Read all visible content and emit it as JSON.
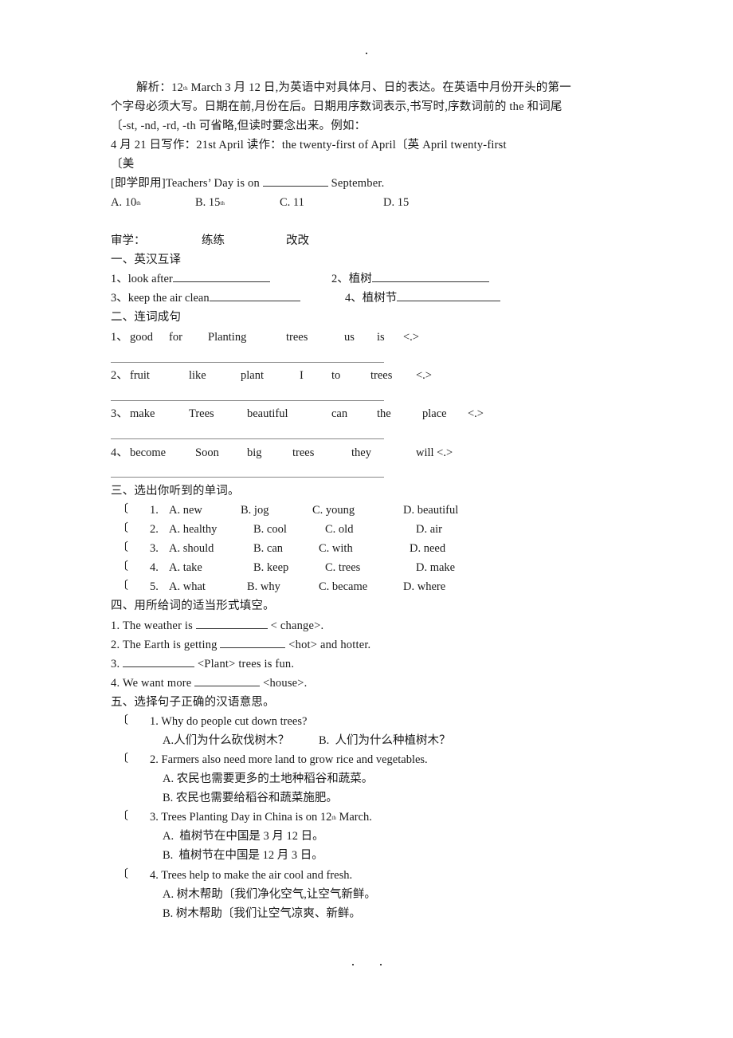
{
  "page_marks": {
    "top": ".",
    "bottom_left": ".",
    "bottom_right": "."
  },
  "intro": {
    "lines": [
      "解析：12",
      "th",
      " March 3 月 12 日,为英语中对具体月、日的表达。在英语中月份开头的第一",
      "个字母必须大写。日期在前,月份在后。日期用序数词表示,书写时,序数词前的 the 和词尾",
      "〔-st, -nd, -rd, -th 可省略,但读时要念出来。例如：",
      "4 月 21 日写作：21st April 读作：the twenty-first of April〔英 April twenty-first",
      "〔美"
    ]
  },
  "practice": {
    "question_prefix": "[即学即用]Teachers’ Day is on ",
    "question_suffix": " September.",
    "options": [
      {
        "letter": "A.",
        "text": "10",
        "sup": "th"
      },
      {
        "letter": "B.",
        "text": "15",
        "sup": "th"
      },
      {
        "letter": "C.",
        "text": "11",
        "sup": ""
      },
      {
        "letter": "D.",
        "text": "15",
        "sup": ""
      }
    ]
  },
  "review_header": {
    "a": "审学：",
    "b": "练练",
    "c": "改改"
  },
  "section1": {
    "title": "一、英汉互译",
    "items": [
      {
        "label": "1、look after"
      },
      {
        "label": "2、植树"
      },
      {
        "label": "3、keep the air clean"
      },
      {
        "label": "4、植树节"
      }
    ]
  },
  "section2": {
    "title": "二、连词成句",
    "items": [
      {
        "num": "1、",
        "words": [
          "good",
          "for",
          "Planting",
          "trees",
          "us",
          "is",
          "<.>"
        ]
      },
      {
        "num": "2、",
        "words": [
          "fruit",
          "like",
          "plant",
          "I",
          "to",
          "trees",
          "<.>"
        ]
      },
      {
        "num": "3、",
        "words": [
          "make",
          "Trees",
          "beautiful",
          "can",
          "the",
          "place",
          "<.>"
        ]
      },
      {
        "num": "4、",
        "words": [
          "become",
          "Soon",
          "big",
          "trees",
          "they",
          "will <.>"
        ]
      }
    ]
  },
  "section3": {
    "title": "三、选出你听到的单词。",
    "paren": "〔",
    "items": [
      {
        "num": "1.",
        "a": "A. new",
        "b": "B. jog",
        "c": "C. young",
        "d": "D. beautiful"
      },
      {
        "num": "2.",
        "a": "A. healthy",
        "b": "B. cool",
        "c": "C. old",
        "d": "D. air"
      },
      {
        "num": "3.",
        "a": "A. should",
        "b": "B. can",
        "c": "C. with",
        "d": "D. need"
      },
      {
        "num": "4.",
        "a": "A. take",
        "b": "B. keep",
        "c": "C. trees",
        "d": "D. make"
      },
      {
        "num": "5.",
        "a": "A. what",
        "b": "B. why",
        "c": "C. became",
        "d": "D. where"
      }
    ]
  },
  "section4": {
    "title": "四、用所给词的适当形式填空。",
    "items": [
      {
        "pre": "1. The weather is ",
        "post": " < change>."
      },
      {
        "pre": "2. The Earth is getting ",
        "post": " <hot> and hotter."
      },
      {
        "pre": "3. ",
        "post": " <Plant> trees is fun."
      },
      {
        "pre": "4. We want more ",
        "post": " <house>."
      }
    ]
  },
  "section5": {
    "title": "五、选择句子正确的汉语意思。",
    "paren": "〔",
    "items": [
      {
        "q": "1. Why do people cut down trees?",
        "a": "A.人们为什么砍伐树木？",
        "b": "B.  人们为什么种植树木？"
      },
      {
        "q": "2. Farmers also need more land to grow rice and vegetables.",
        "a": "A. 农民也需要更多的土地种稻谷和蔬菜。",
        "b": "B. 农民也需要给稻谷和蔬菜施肥。"
      },
      {
        "q_pre": "3. Trees Planting Day in China is on 12",
        "q_sup": "th",
        "q_post": " March.",
        "a": "A.  植树节在中国是 3 月 12 日。",
        "b": "B.  植树节在中国是 12 月 3 日。"
      },
      {
        "q": "4. Trees help to make the air cool and fresh.",
        "a": "A. 树木帮助〔我们净化空气,让空气新鲜。",
        "b": "B. 树木帮助〔我们让空气凉爽、新鲜。"
      }
    ]
  }
}
